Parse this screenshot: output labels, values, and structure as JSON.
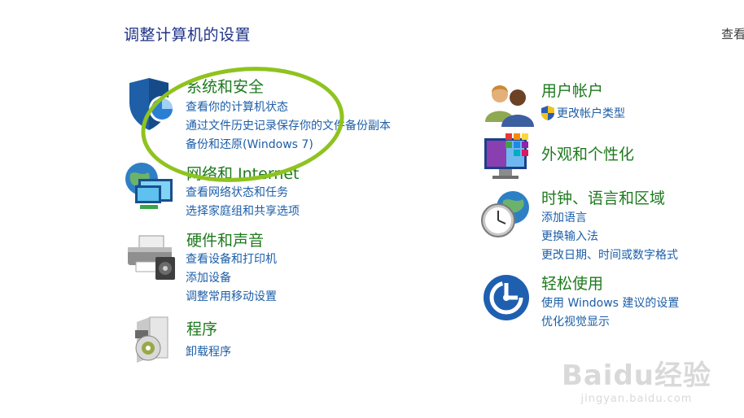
{
  "header": {
    "title": "调整计算机的设置",
    "view_by": "查看"
  },
  "categories": {
    "security": {
      "title": "系统和安全",
      "icon": "security-shield-icon",
      "links": [
        "查看你的计算机状态",
        "通过文件历史记录保存你的文件备份副本",
        "备份和还原(Windows 7)"
      ]
    },
    "network": {
      "title": "网络和 Internet",
      "icon": "network-globe-icon",
      "links": [
        "查看网络状态和任务",
        "选择家庭组和共享选项"
      ]
    },
    "hardware": {
      "title": "硬件和声音",
      "icon": "printer-icon",
      "links": [
        "查看设备和打印机",
        "添加设备",
        "调整常用移动设置"
      ]
    },
    "programs": {
      "title": "程序",
      "icon": "programs-box-icon",
      "links": [
        "卸载程序"
      ]
    },
    "accounts": {
      "title": "用户帐户",
      "icon": "users-icon",
      "links": [
        "更改帐户类型"
      ]
    },
    "appearance": {
      "title": "外观和个性化",
      "icon": "monitor-palette-icon",
      "links": []
    },
    "clock": {
      "title": "时钟、语言和区域",
      "icon": "clock-globe-icon",
      "links": [
        "添加语言",
        "更换输入法",
        "更改日期、时间或数字格式"
      ]
    },
    "ease": {
      "title": "轻松使用",
      "icon": "ease-of-access-icon",
      "links": [
        "使用 Windows 建议的设置",
        "优化视觉显示"
      ]
    }
  },
  "watermark": {
    "logo": "Baidu经验",
    "url": "jingyan.baidu.com"
  }
}
